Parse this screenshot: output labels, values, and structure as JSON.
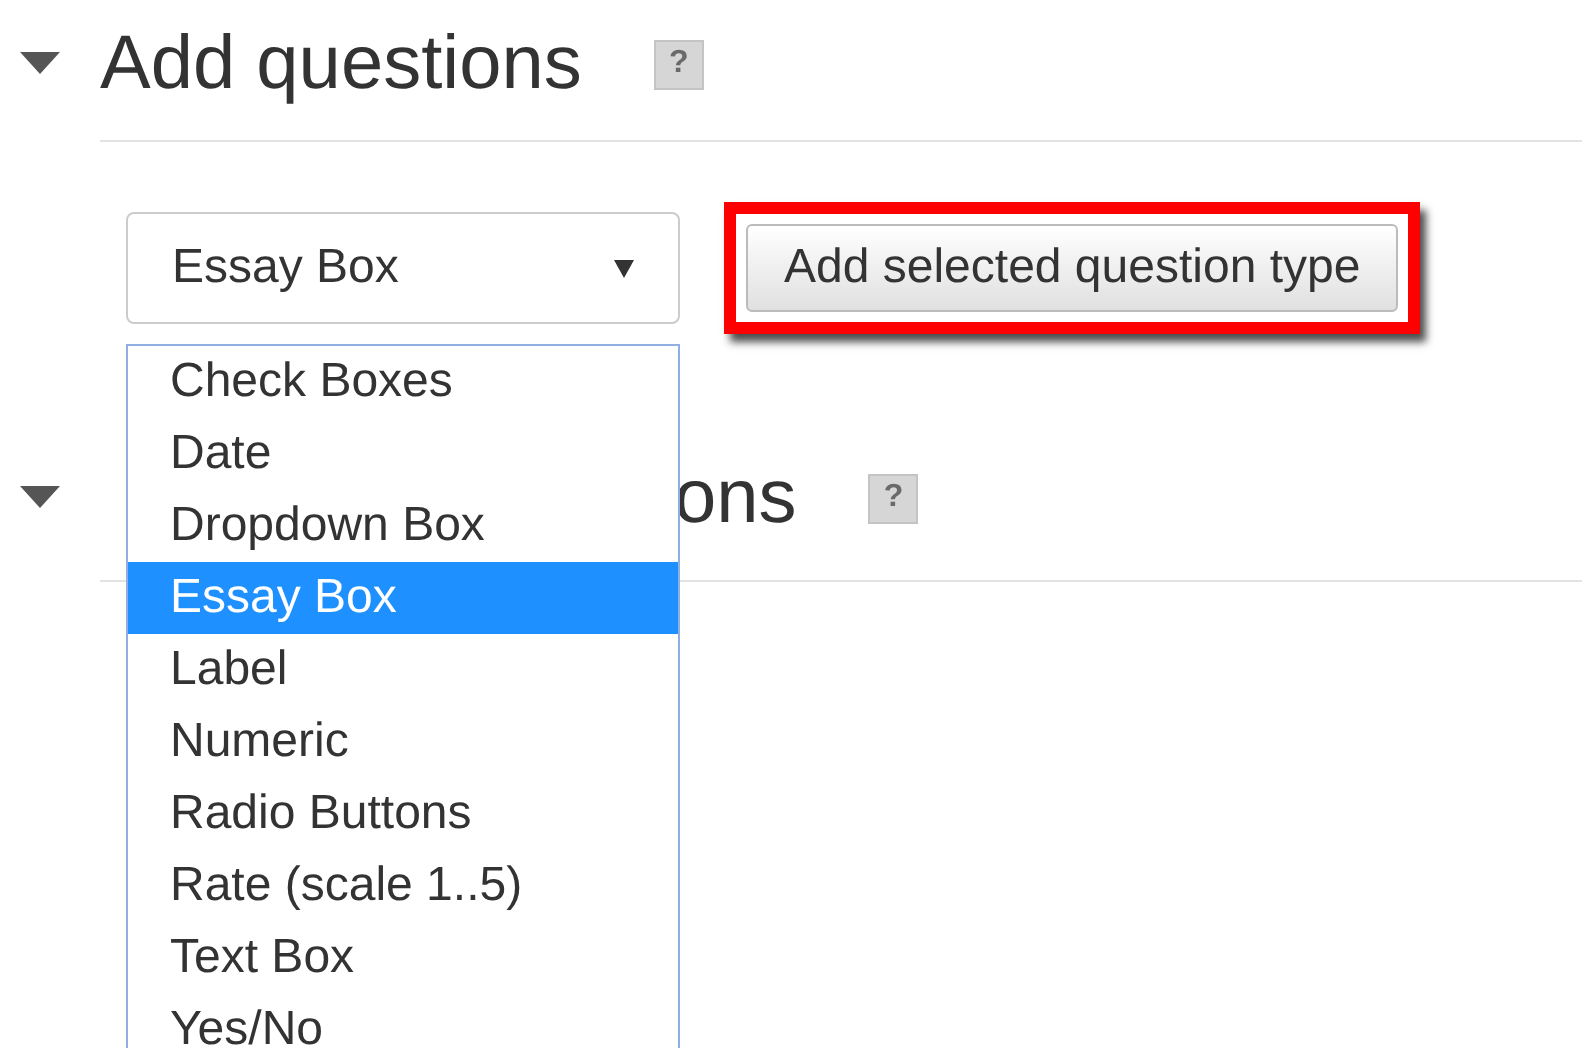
{
  "sections": [
    {
      "title_parts": [
        "Add questions"
      ],
      "expanded": true,
      "help": "?"
    },
    {
      "title_parts": [
        "ons"
      ],
      "expanded": true,
      "help": "?"
    }
  ],
  "question_type_select": {
    "value": "Essay Box",
    "open": true
  },
  "add_button": {
    "label": "Add selected question type",
    "highlighted": true
  },
  "dropdown_options": [
    {
      "label": "Check Boxes",
      "selected": false
    },
    {
      "label": "Date",
      "selected": false
    },
    {
      "label": "Dropdown Box",
      "selected": false
    },
    {
      "label": "Essay Box",
      "selected": true
    },
    {
      "label": "Label",
      "selected": false
    },
    {
      "label": "Numeric",
      "selected": false
    },
    {
      "label": "Radio Buttons",
      "selected": false
    },
    {
      "label": "Rate (scale 1..5)",
      "selected": false
    },
    {
      "label": "Text Box",
      "selected": false
    },
    {
      "label": "Yes/No",
      "selected": false
    }
  ]
}
